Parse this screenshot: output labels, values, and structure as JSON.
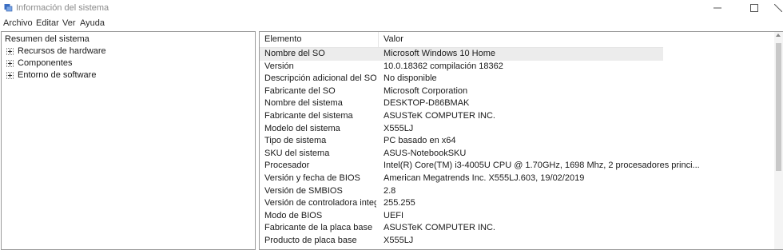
{
  "window": {
    "title": "Información del sistema",
    "icon": "system-info-icon",
    "controls": [
      "minimize-icon",
      "maximize-icon",
      "close-icon"
    ]
  },
  "menu": [
    {
      "label": "Archivo"
    },
    {
      "label": "Editar"
    },
    {
      "label": "Ver"
    },
    {
      "label": "Ayuda"
    }
  ],
  "tree": {
    "root": "Resumen del sistema",
    "children": [
      {
        "label": "Recursos de hardware"
      },
      {
        "label": "Componentes"
      },
      {
        "label": "Entorno de software"
      }
    ]
  },
  "table": {
    "headers": [
      "Elemento",
      "Valor"
    ],
    "rows": [
      {
        "label": "Nombre del SO",
        "value": "Microsoft Windows 10 Home",
        "selected": true
      },
      {
        "label": "Versión",
        "value": "10.0.18362 compilación 18362"
      },
      {
        "label": "Descripción adicional del SO",
        "value": "No disponible"
      },
      {
        "label": "Fabricante del SO",
        "value": "Microsoft Corporation"
      },
      {
        "label": "Nombre del sistema",
        "value": "DESKTOP-D86BMAK"
      },
      {
        "label": "Fabricante del sistema",
        "value": "ASUSTeK COMPUTER INC."
      },
      {
        "label": "Modelo del sistema",
        "value": "X555LJ"
      },
      {
        "label": "Tipo de sistema",
        "value": "PC basado en x64"
      },
      {
        "label": "SKU del sistema",
        "value": "ASUS-NotebookSKU"
      },
      {
        "label": "Procesador",
        "value": "Intel(R) Core(TM) i3-4005U CPU @ 1.70GHz, 1698 Mhz, 2 procesadores princi..."
      },
      {
        "label": "Versión y fecha de BIOS",
        "value": "American Megatrends Inc. X555LJ.603, 19/02/2019"
      },
      {
        "label": "Versión de SMBIOS",
        "value": "2.8"
      },
      {
        "label": "Versión de controladora integr...",
        "value": "255.255"
      },
      {
        "label": "Modo de BIOS",
        "value": "UEFI"
      },
      {
        "label": "Fabricante de la placa base",
        "value": "ASUSTeK COMPUTER INC."
      },
      {
        "label": "Producto de placa base",
        "value": "X555LJ"
      }
    ]
  }
}
